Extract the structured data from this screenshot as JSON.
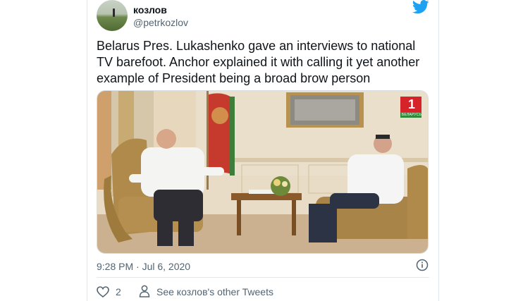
{
  "tweet": {
    "display_name": "козлов",
    "handle": "@petrkozlov",
    "text": "Belarus Pres. Lukashenko gave an interviews to national TV barefoot. Anchor explained it with calling it yet another example of President being a broad brow person",
    "timestamp": "9:28 PM · Jul 6, 2020",
    "likes": "2",
    "see_other": "See козлов's other Tweets"
  },
  "media": {
    "channel_badge": "1",
    "channel_sub": "БЕЛАРУСЬ"
  },
  "icons": {
    "platform": "twitter-bird-icon",
    "info": "info-icon",
    "like": "heart-icon",
    "profile": "person-icon"
  },
  "colors": {
    "brand": "#1da1f2",
    "secondary_text": "#536471",
    "badge_red": "#d6232a",
    "badge_green": "#2f8b3a"
  }
}
